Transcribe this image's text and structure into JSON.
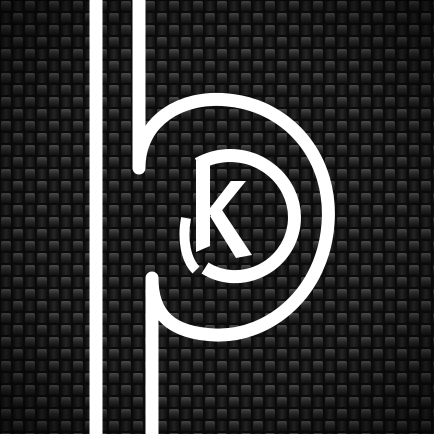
{
  "image": {
    "kind": "logo",
    "background": "carbon-fiber",
    "colors": {
      "base": "#0b0b0b",
      "weave_dark": "#141414",
      "weave_mid": "#2a2a2a",
      "weave_light": "#4a4a4a",
      "mark": "#ffffff"
    }
  },
  "logo": {
    "letter": "K",
    "icon_name": "pk-monogram-icon"
  }
}
